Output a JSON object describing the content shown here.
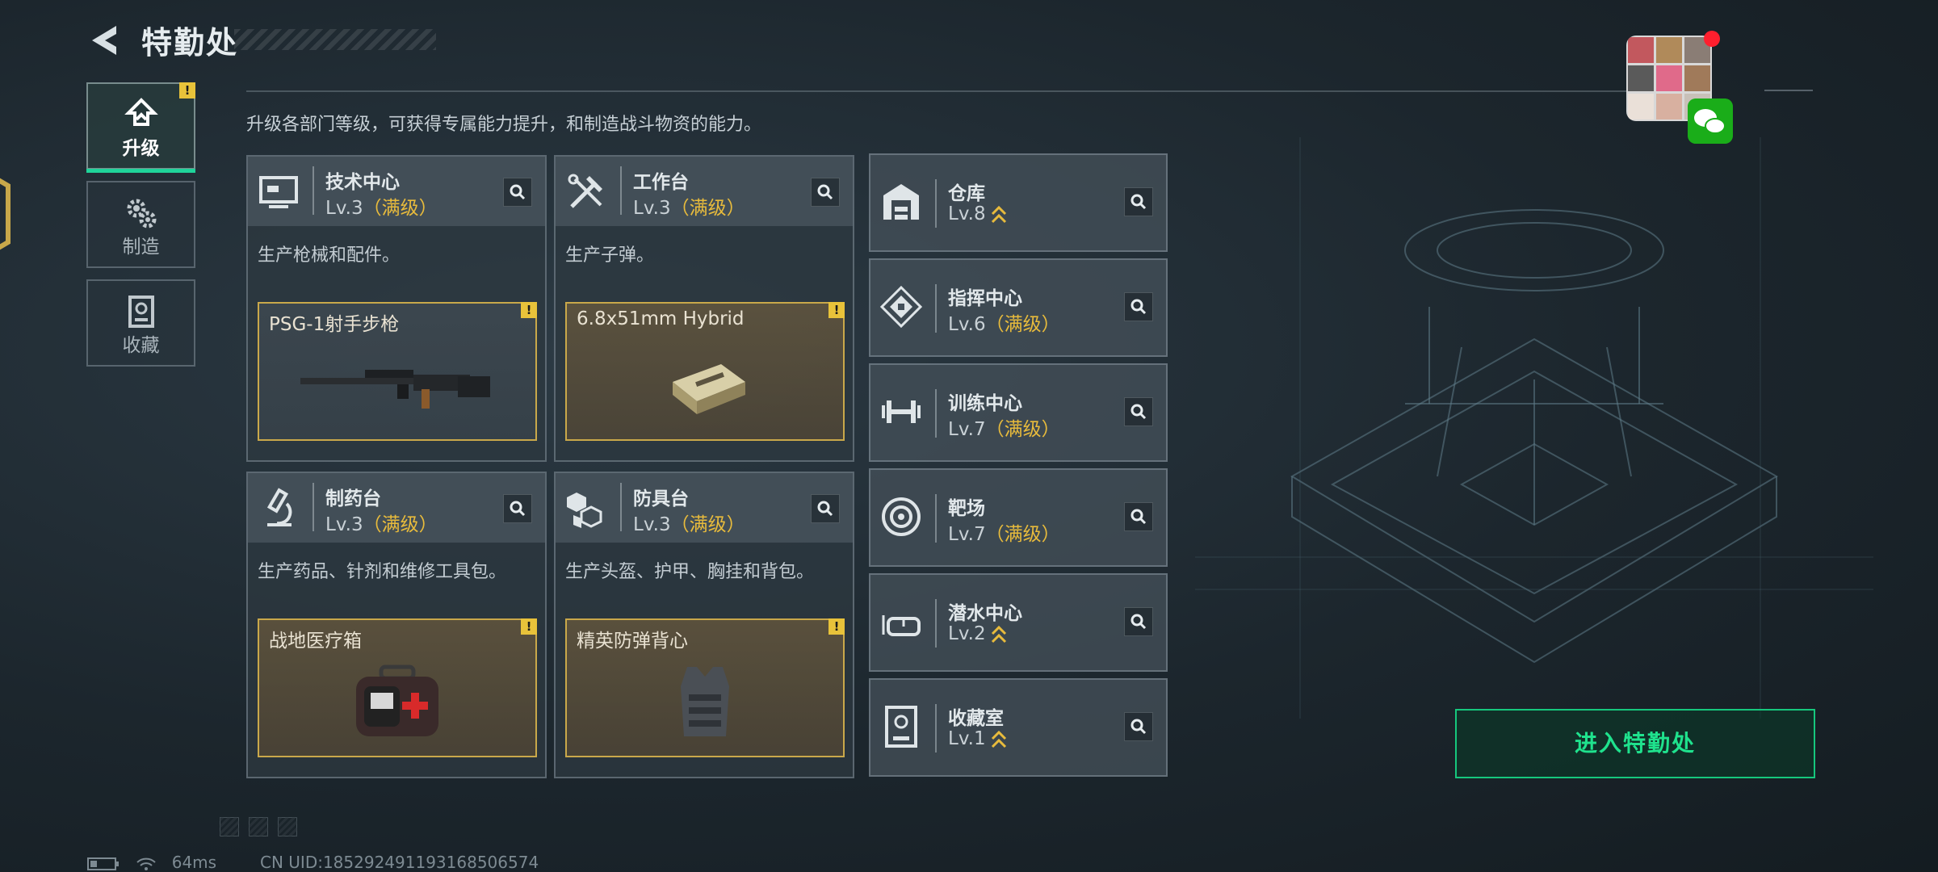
{
  "header": {
    "title": "特勤处",
    "description": "升级各部门等级，可获得专属能力提升，和制造战斗物资的能力。"
  },
  "tabs": [
    {
      "label": "升级",
      "icon": "upgrade-icon",
      "active": true
    },
    {
      "label": "制造",
      "icon": "gears-icon"
    },
    {
      "label": "收藏",
      "icon": "collection-icon"
    }
  ],
  "cards": [
    {
      "name": "技术中心",
      "level": "Lv.3",
      "max": "（满级）",
      "desc": "生产枪械和配件。",
      "product": "PSG-1射手步枪",
      "icon": "monitor-icon",
      "product_icon": "rifle-icon"
    },
    {
      "name": "工作台",
      "level": "Lv.3",
      "max": "（满级）",
      "desc": "生产子弹。",
      "product": "6.8x51mm Hybrid",
      "icon": "tools-icon",
      "product_icon": "ammo-box-icon"
    },
    {
      "name": "制药台",
      "level": "Lv.3",
      "max": "（满级）",
      "desc": "生产药品、针剂和维修工具包。",
      "product": "战地医疗箱",
      "icon": "microscope-icon",
      "product_icon": "medkit-icon"
    },
    {
      "name": "防具台",
      "level": "Lv.3",
      "max": "（满级）",
      "desc": "生产头盔、护甲、胸挂和背包。",
      "product": "精英防弹背心",
      "icon": "armor-cubes-icon",
      "product_icon": "vest-icon"
    }
  ],
  "side_cards": [
    {
      "name": "仓库",
      "level": "Lv.8",
      "max": "",
      "upgradable": true,
      "icon": "warehouse-icon"
    },
    {
      "name": "指挥中心",
      "level": "Lv.6",
      "max": "（满级）",
      "upgradable": false,
      "icon": "command-icon"
    },
    {
      "name": "训练中心",
      "level": "Lv.7",
      "max": "（满级）",
      "upgradable": false,
      "icon": "dumbbell-icon"
    },
    {
      "name": "靶场",
      "level": "Lv.7",
      "max": "（满级）",
      "upgradable": false,
      "icon": "target-icon"
    },
    {
      "name": "潜水中心",
      "level": "Lv.2",
      "max": "",
      "upgradable": true,
      "icon": "diving-mask-icon"
    },
    {
      "name": "收藏室",
      "level": "Lv.1",
      "max": "",
      "upgradable": true,
      "icon": "display-case-icon"
    }
  ],
  "enter_button": "进入特勤处",
  "footer": {
    "ping": "64ms",
    "uid": "CN UID:18529249119316850657​4"
  },
  "colors": {
    "accent_green": "#1fe28d",
    "max_gold": "#e8bb3c",
    "warn_yellow": "#e8c23a"
  }
}
